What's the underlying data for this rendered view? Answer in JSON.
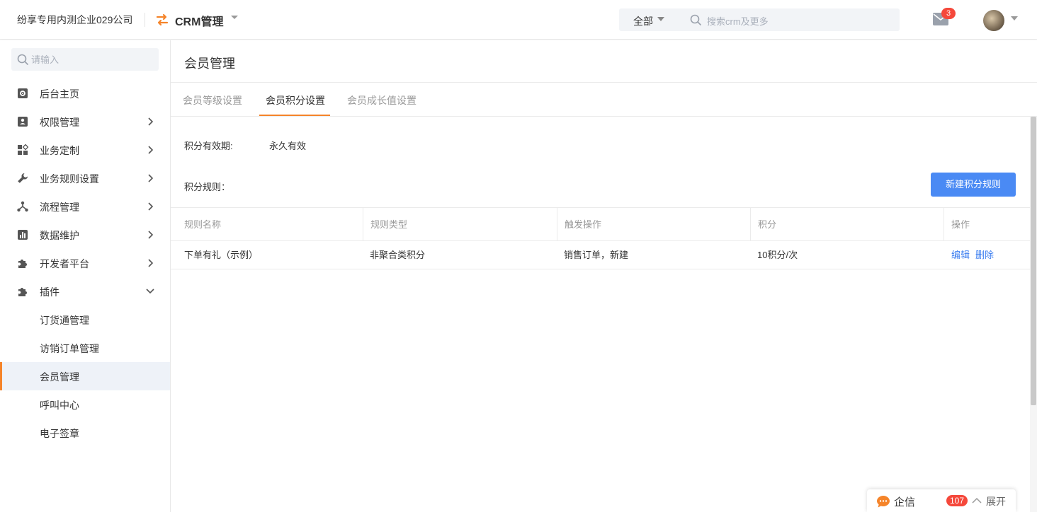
{
  "header": {
    "company": "纷享专用内测企业029公司",
    "app_name": "CRM管理",
    "search_scope": "全部",
    "search_placeholder": "搜索crm及更多",
    "mail_badge": "3"
  },
  "sidebar": {
    "search_placeholder": "请输入",
    "items": [
      {
        "label": "后台主页",
        "icon": "gear-icon"
      },
      {
        "label": "权限管理",
        "icon": "user-card-icon"
      },
      {
        "label": "业务定制",
        "icon": "widgets-icon"
      },
      {
        "label": "业务规则设置",
        "icon": "wrench-icon"
      },
      {
        "label": "流程管理",
        "icon": "flow-icon"
      },
      {
        "label": "数据维护",
        "icon": "bar-chart-icon"
      },
      {
        "label": "开发者平台",
        "icon": "puzzle-icon"
      },
      {
        "label": "插件",
        "icon": "puzzle-icon"
      }
    ],
    "plugin_children": [
      "订货通管理",
      "访销订单管理",
      "会员管理",
      "呼叫中心",
      "电子签章"
    ]
  },
  "main": {
    "title": "会员管理",
    "tabs": [
      "会员等级设置",
      "会员积分设置",
      "会员成长值设置"
    ],
    "validity_label": "积分有效期:",
    "validity_value": "永久有效",
    "rules_label": "积分规则：",
    "new_rule_button": "新建积分规则",
    "table": {
      "columns": [
        "规则名称",
        "规则类型",
        "触发操作",
        "积分",
        "操作"
      ],
      "rows": [
        {
          "name": "下单有礼（示例）",
          "type": "非聚合类积分",
          "trigger": "销售订单，新建",
          "points": "10积分/次",
          "edit": "编辑",
          "delete": "删除"
        }
      ]
    }
  },
  "chat": {
    "label": "企信",
    "badge": "107",
    "expand": "展开"
  },
  "colors": {
    "accent": "#f5842a",
    "primary_button": "#4a8af4",
    "link": "#3e7ff0",
    "badge": "#f5483b"
  }
}
